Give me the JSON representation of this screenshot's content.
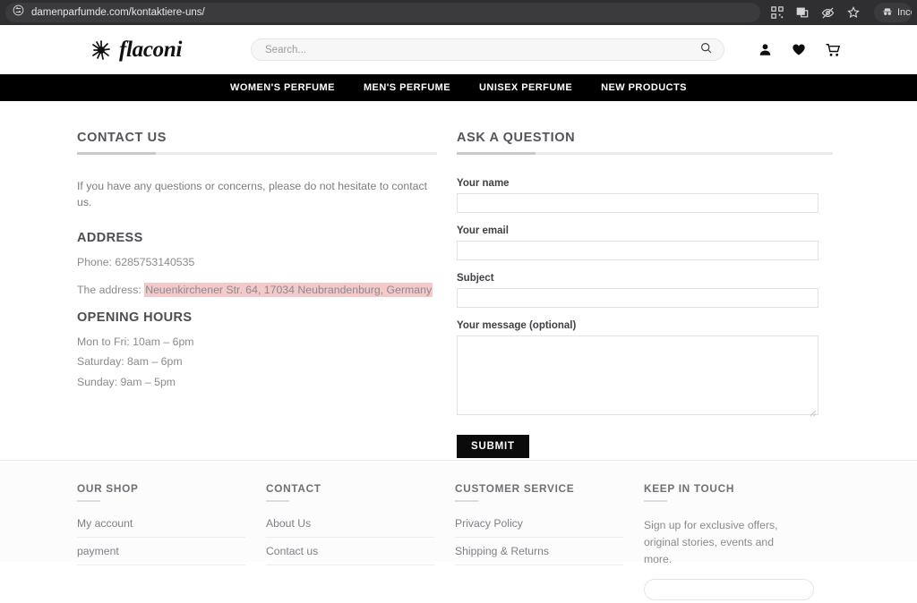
{
  "browser": {
    "url": "damenparfumde.com/kontaktiere-uns/",
    "left_icon": "page-info-icon",
    "toolbar_icons": [
      "qr-code-icon",
      "cast-icon",
      "hide-icon",
      "bookmark-star-icon"
    ],
    "incognito_label": "Inco"
  },
  "header": {
    "brand_name": "flaconi",
    "search_placeholder": "Search...",
    "search_value": "",
    "icons": [
      "account-icon",
      "wishlist-heart-icon",
      "shopping-cart-icon"
    ]
  },
  "nav": {
    "items": [
      {
        "label": "WOMEN'S PERFUME"
      },
      {
        "label": "MEN'S PERFUME"
      },
      {
        "label": "UNISEX PERFUME"
      },
      {
        "label": "NEW PRODUCTS"
      }
    ]
  },
  "contact": {
    "title": "CONTACT US",
    "intro": "If you have any questions or concerns, please do not hesitate to contact us.",
    "address_title": "ADDRESS",
    "phone": "Phone: 6285753140535",
    "address_prefix": "The address: ",
    "address_highlight": "Neuenkirchener Str. 64, 17034 Neubrandenburg, Germany",
    "hours_title": "OPENING HOURS",
    "hours": [
      "Mon to Fri: 10am – 6pm",
      "Saturday: 8am – 6pm",
      "Sunday: 9am – 5pm"
    ]
  },
  "form": {
    "title": "ASK A QUESTION",
    "name_label": "Your name",
    "name_value": "",
    "email_label": "Your email",
    "email_value": "",
    "subject_label": "Subject",
    "subject_value": "",
    "message_label": "Your message (optional)",
    "message_value": "",
    "submit_label": "SUBMIT"
  },
  "footer": {
    "columns": [
      {
        "title": "OUR SHOP",
        "links": [
          "My account",
          "payment"
        ]
      },
      {
        "title": "CONTACT",
        "links": [
          "About Us",
          "Contact us"
        ]
      },
      {
        "title": "CUSTOMER SERVICE",
        "links": [
          "Privacy Policy",
          "Shipping & Returns"
        ]
      }
    ],
    "keep_in_touch": {
      "title": "KEEP IN TOUCH",
      "text": "Sign up for exclusive offers, original stories, events and more.",
      "input_placeholder": "",
      "input_value": ""
    }
  },
  "colors": {
    "nav_background": "#000000",
    "submit_background": "#0b0b0b",
    "highlight": "#f3c9c9",
    "browser_chrome": "#2f2f31"
  }
}
